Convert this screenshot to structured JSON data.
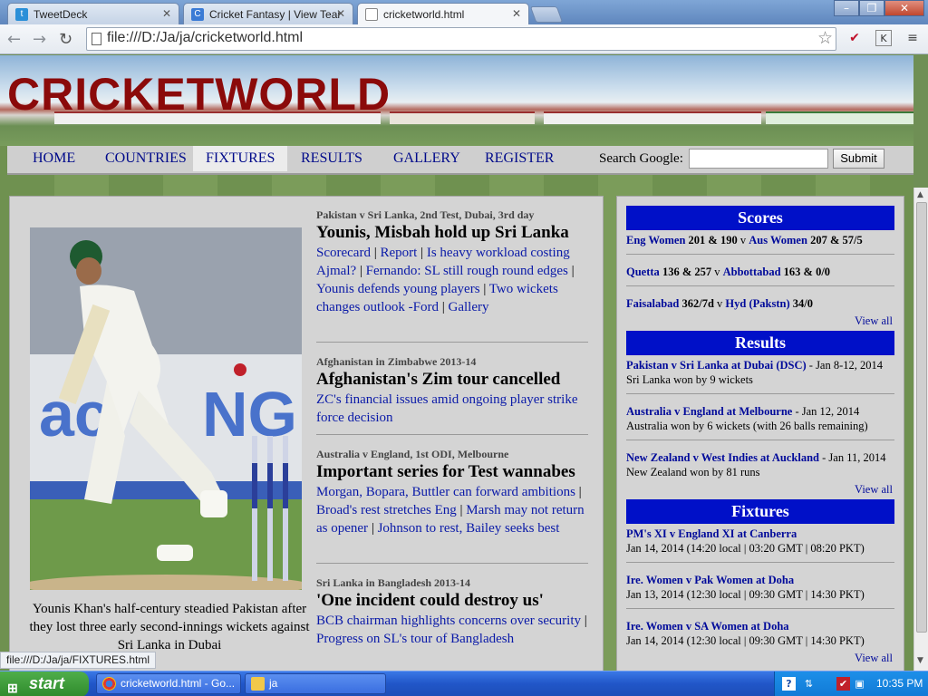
{
  "browser": {
    "tabs": [
      {
        "title": "TweetDeck"
      },
      {
        "title": "Cricket Fantasy | View Team"
      },
      {
        "title": "cricketworld.html"
      }
    ],
    "address": "file:///D:/Ja/ja/cricketworld.html",
    "status_url": "file:///D:/Ja/ja/FIXTURES.html"
  },
  "site": {
    "logo": "CRICKETWORLD",
    "nav": [
      "HOME",
      "COUNTRIES",
      "FIXTURES",
      "RESULTS",
      "GALLERY",
      "REGISTER"
    ],
    "search_label": "Search Google:",
    "search_button": "Submit"
  },
  "feature": {
    "caption": "Younis Khan's half-century steadied Pakistan after they lost three early second-innings wickets against Sri Lanka in Dubai"
  },
  "stories": [
    {
      "kicker": "Pakistan v Sri Lanka, 2nd Test, Dubai, 3rd day",
      "headline": "Younis, Misbah hold up Sri Lanka",
      "links": [
        "Scorecard",
        "Report",
        "Is heavy workload costing Ajmal?",
        "Fernando: SL still rough round edges",
        "Younis defends young players",
        "Two wickets changes outlook -Ford",
        "Gallery"
      ]
    },
    {
      "kicker": "Afghanistan in Zimbabwe 2013-14",
      "headline": "Afghanistan's Zim tour cancelled",
      "links": [
        "ZC's financial issues amid ongoing player strike force decision"
      ]
    },
    {
      "kicker": "Australia v England, 1st ODI, Melbourne",
      "headline": "Important series for Test wannabes",
      "links": [
        "Morgan, Bopara, Buttler can forward ambitions",
        "Broad's rest stretches Eng",
        "Marsh may not return as opener",
        "Johnson to rest, Bailey seeks best"
      ]
    },
    {
      "kicker": "Sri Lanka in Bangladesh 2013-14",
      "headline": "'One incident could destroy us'",
      "links": [
        "BCB chairman highlights concerns over security",
        "Progress on SL's tour of Bangladesh"
      ]
    }
  ],
  "sidebar": {
    "scores_title": "Scores",
    "scores": [
      {
        "team1": "Eng Women",
        "s1": "201 & 190",
        "v": "v",
        "team2": "Aus Women",
        "s2": "207 & 57/5"
      },
      {
        "team1": "Quetta",
        "s1": "136 & 257",
        "v": "v",
        "team2": "Abbottabad",
        "s2": "163 & 0/0"
      },
      {
        "team1": "Faisalabad",
        "s1": "362/7d",
        "v": "v",
        "team2": "Hyd (Pakstn)",
        "s2": "34/0"
      }
    ],
    "results_title": "Results",
    "results": [
      {
        "match": "Pakistan v Sri Lanka at Dubai (DSC)",
        "date": " - Jan 8-12, 2014",
        "outcome": "Sri Lanka won by 9 wickets"
      },
      {
        "match": "Australia v England at Melbourne",
        "date": " - Jan 12, 2014",
        "outcome": "Australia won by 6 wickets (with 26 balls remaining)"
      },
      {
        "match": "New Zealand v West Indies at Auckland",
        "date": " - Jan 11, 2014",
        "outcome": "New Zealand won by 81 runs"
      }
    ],
    "fixtures_title": "Fixtures",
    "fixtures": [
      {
        "match": "PM's XI v England XI at Canberra",
        "time": "Jan 14, 2014 (14:20 local | 03:20 GMT | 08:20 PKT)"
      },
      {
        "match": "Ire. Women v Pak Women at Doha",
        "time": "Jan 13, 2014 (12:30 local | 09:30 GMT | 14:30 PKT)"
      },
      {
        "match": "Ire. Women v SA Women at Doha",
        "time": "Jan 14, 2014 (12:30 local | 09:30 GMT | 14:30 PKT)"
      }
    ],
    "view_all": "View all"
  },
  "taskbar": {
    "start": "start",
    "items": [
      "cricketworld.html - Go...",
      "ja"
    ],
    "clock": "10:35 PM"
  },
  "colors": {
    "logo": "#8b0a0a",
    "link": "#0a1aa8",
    "sidebar_header": "#0010c8"
  }
}
